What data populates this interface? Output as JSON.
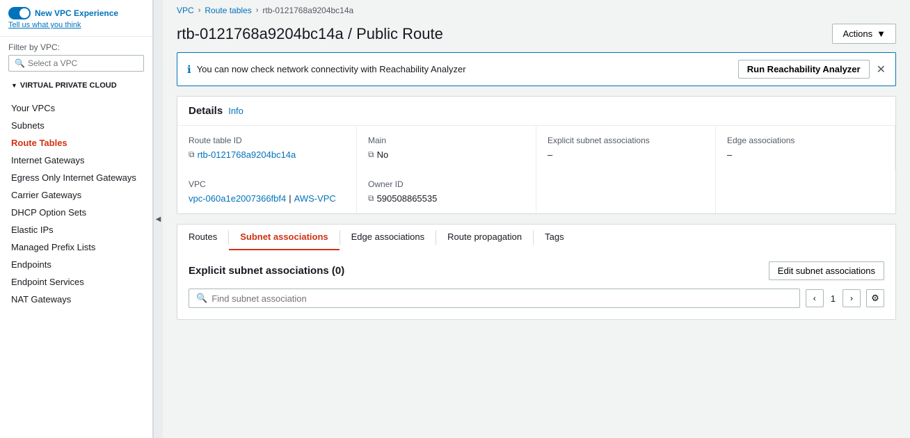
{
  "sidebar": {
    "toggle_label": "New VPC Experience",
    "tell_us": "Tell us what you think",
    "filter_label": "Filter by VPC:",
    "filter_placeholder": "Select a VPC",
    "section_label": "VIRTUAL PRIVATE CLOUD",
    "items": [
      {
        "label": "Your VPCs",
        "active": false
      },
      {
        "label": "Subnets",
        "active": false
      },
      {
        "label": "Route Tables",
        "active": true
      },
      {
        "label": "Internet Gateways",
        "active": false
      },
      {
        "label": "Egress Only Internet Gateways",
        "active": false
      },
      {
        "label": "Carrier Gateways",
        "active": false
      },
      {
        "label": "DHCP Option Sets",
        "active": false
      },
      {
        "label": "Elastic IPs",
        "active": false
      },
      {
        "label": "Managed Prefix Lists",
        "active": false
      },
      {
        "label": "Endpoints",
        "active": false
      },
      {
        "label": "Endpoint Services",
        "active": false
      },
      {
        "label": "NAT Gateways",
        "active": false
      }
    ]
  },
  "breadcrumb": {
    "vpc": "VPC",
    "route_tables": "Route tables",
    "current": "rtb-0121768a9204bc14a"
  },
  "page_title": "rtb-0121768a9204bc14a / Public Route",
  "actions_label": "Actions",
  "banner": {
    "text": "You can now check network connectivity with Reachability Analyzer",
    "button": "Run Reachability Analyzer"
  },
  "details": {
    "title": "Details",
    "info": "Info",
    "fields": {
      "route_table_id_label": "Route table ID",
      "route_table_id_value": "rtb-0121768a9204bc14a",
      "main_label": "Main",
      "main_value": "No",
      "explicit_subnet_label": "Explicit subnet associations",
      "explicit_subnet_value": "–",
      "edge_assoc_label": "Edge associations",
      "edge_assoc_value": "–",
      "vpc_label": "VPC",
      "vpc_value": "vpc-060a1e2007366fbf4",
      "vpc_name": "AWS-VPC",
      "owner_id_label": "Owner ID",
      "owner_id_value": "590508865535"
    }
  },
  "tabs": [
    {
      "label": "Routes",
      "active": false
    },
    {
      "label": "Subnet associations",
      "active": true
    },
    {
      "label": "Edge associations",
      "active": false
    },
    {
      "label": "Route propagation",
      "active": false
    },
    {
      "label": "Tags",
      "active": false
    }
  ],
  "subnet_section": {
    "title": "Explicit subnet associations",
    "count": "(0)",
    "edit_button": "Edit subnet associations",
    "search_placeholder": "Find subnet association",
    "page_number": "1"
  }
}
